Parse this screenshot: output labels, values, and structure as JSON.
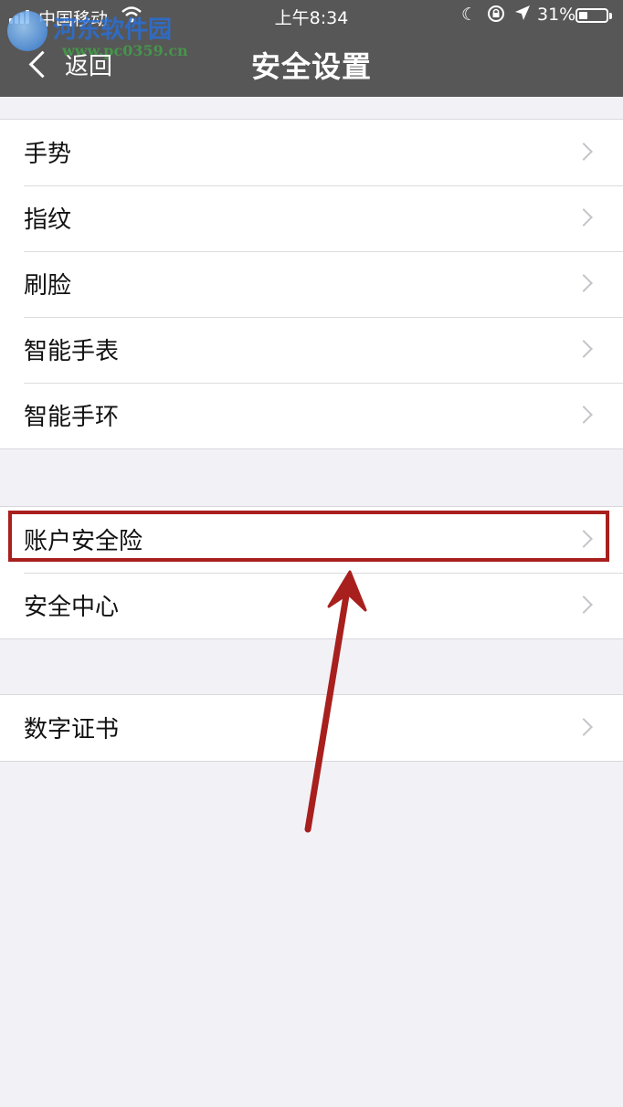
{
  "status_bar": {
    "carrier": "中国移动",
    "time": "上午8:34",
    "battery": "31%"
  },
  "nav": {
    "back_label": "返回",
    "title": "安全设置"
  },
  "watermark": {
    "name": "河东软件园",
    "url": "www.pc0359.cn"
  },
  "groups": [
    {
      "items": [
        "手势",
        "指纹",
        "刷脸",
        "智能手表",
        "智能手环"
      ]
    },
    {
      "items": [
        "账户安全险",
        "安全中心"
      ]
    },
    {
      "items": [
        "数字证书"
      ]
    }
  ],
  "annotation": {
    "highlight_color": "#a8201e",
    "highlighted_item": "账户安全险"
  }
}
